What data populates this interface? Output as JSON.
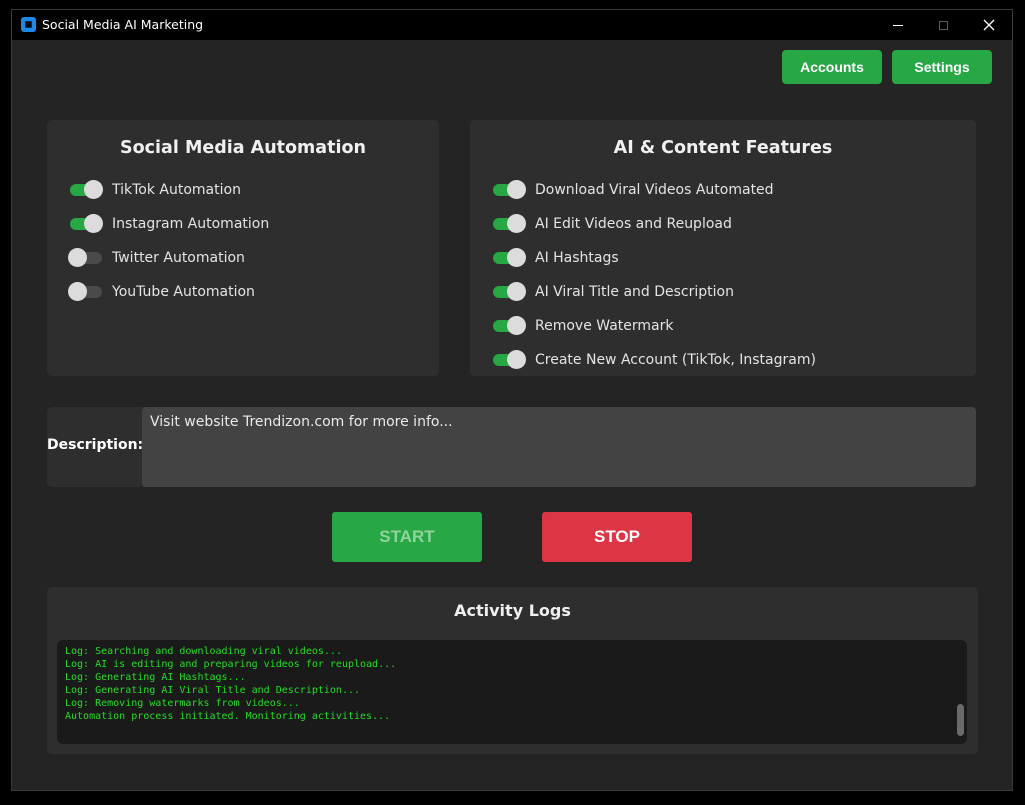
{
  "window": {
    "title": "Social Media AI Marketing"
  },
  "header": {
    "accounts_label": "Accounts",
    "settings_label": "Settings"
  },
  "social": {
    "title": "Social Media Automation",
    "toggles": [
      {
        "label": "TikTok Automation",
        "on": true
      },
      {
        "label": "Instagram Automation",
        "on": true
      },
      {
        "label": "Twitter Automation",
        "on": false
      },
      {
        "label": "YouTube Automation",
        "on": false
      }
    ]
  },
  "ai": {
    "title": "AI & Content Features",
    "toggles": [
      {
        "label": "Download Viral Videos Automated",
        "on": true
      },
      {
        "label": "AI Edit Videos and Reupload",
        "on": true
      },
      {
        "label": "AI Hashtags",
        "on": true
      },
      {
        "label": "AI Viral Title and Description",
        "on": true
      },
      {
        "label": "Remove Watermark",
        "on": true
      },
      {
        "label": "Create New Account (TikTok, Instagram)",
        "on": true
      }
    ]
  },
  "description": {
    "label": "Description:",
    "value": "Visit website Trendizon.com for more info..."
  },
  "controls": {
    "start_label": "START",
    "stop_label": "STOP"
  },
  "logs": {
    "title": "Activity Logs",
    "lines": [
      "Log: Searching and downloading viral videos...",
      "Log: AI is editing and preparing videos for reupload...",
      "Log: Generating AI Hashtags...",
      "Log: Generating AI Viral Title and Description...",
      "Log: Removing watermarks from videos...",
      "Automation process initiated. Monitoring activities..."
    ]
  },
  "colors": {
    "accent_green": "#28a745",
    "stop_red": "#dc3545",
    "log_green": "#22dd22"
  }
}
